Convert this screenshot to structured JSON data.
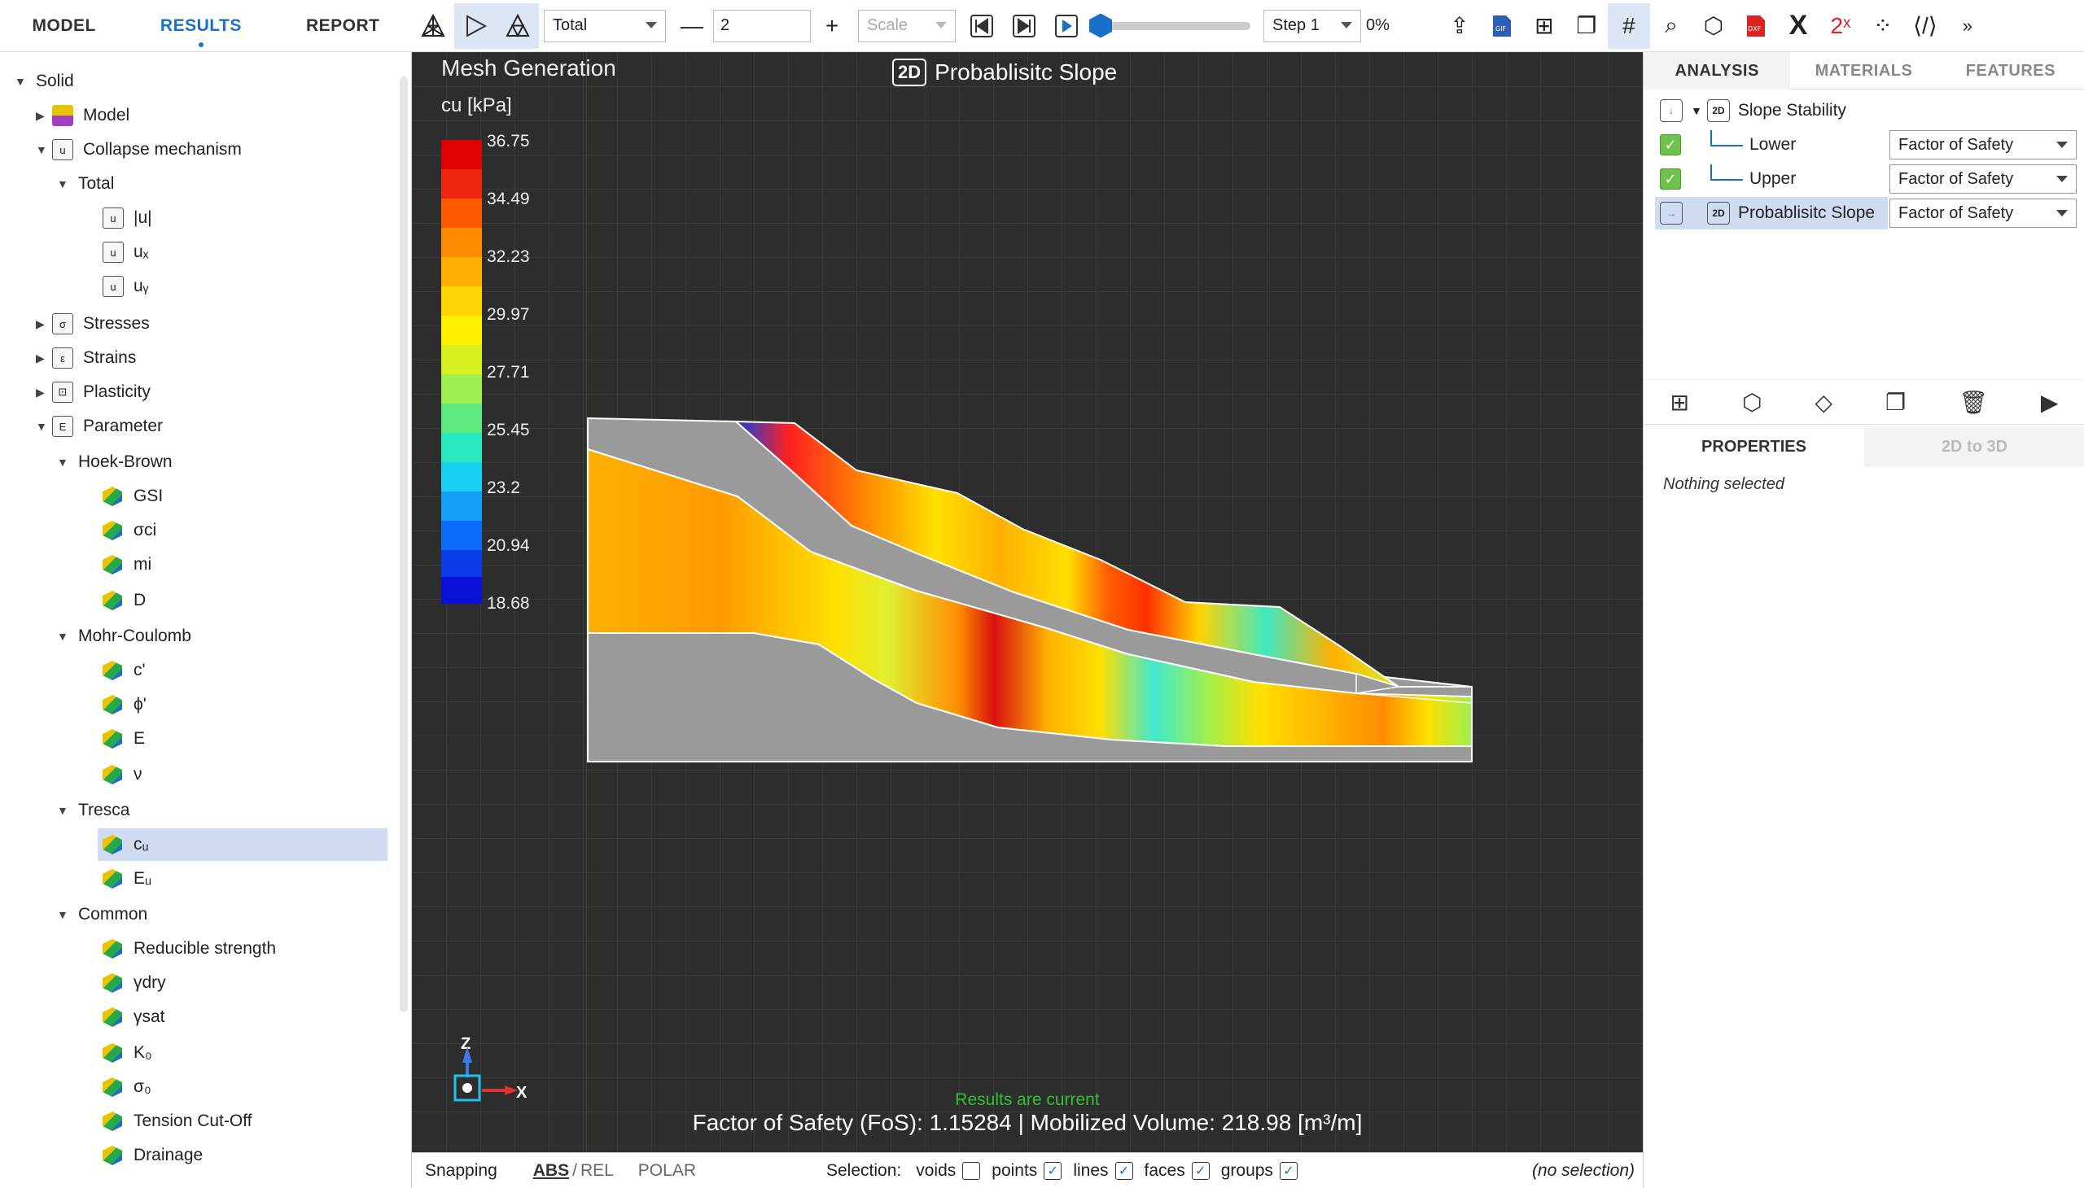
{
  "nav": {
    "model": "MODEL",
    "results": "RESULTS",
    "report": "REPORT"
  },
  "toolbar": {
    "result_type": "Total",
    "step_size": "2",
    "scale_placeholder": "Scale",
    "step_select": "Step 1",
    "progress_percent": "0%",
    "progress_value": 0
  },
  "tree": {
    "solid": "Solid",
    "model": "Model",
    "collapse": "Collapse mechanism",
    "total": "Total",
    "u_abs": "|u|",
    "ux": "uₓ",
    "uy": "uᵧ",
    "stresses": "Stresses",
    "strains": "Strains",
    "plasticity": "Plasticity",
    "parameter": "Parameter",
    "hoek_brown": "Hoek-Brown",
    "gsi": "GSI",
    "sigma_ci": "σci",
    "mi": "mi",
    "d": "D",
    "mohr_coulomb": "Mohr-Coulomb",
    "c_prime": "c'",
    "phi_prime": "ϕ'",
    "e": "E",
    "nu": "ν",
    "tresca": "Tresca",
    "cu": "cᵤ",
    "eu": "Eᵤ",
    "common": "Common",
    "reducible": "Reducible strength",
    "gamma_dry": "γdry",
    "gamma_sat": "γsat",
    "k0": "K₀",
    "sigma0": "σ₀",
    "tension": "Tension Cut-Off",
    "drainage": "Drainage"
  },
  "viewport": {
    "title": "Mesh Generation",
    "badge": "2D",
    "model_name": "Probablisitc Slope",
    "legend_label": "cu [kPa]",
    "legend_ticks": [
      "36.75",
      "34.49",
      "32.23",
      "29.97",
      "27.71",
      "25.45",
      "23.2",
      "20.94",
      "18.68"
    ],
    "status": "Results are current",
    "fos_text": "Factor of Safety (FoS): 1.15284 | Mobilized Volume: 218.98 [m³/m]",
    "axis_z": "Z",
    "axis_x": "X"
  },
  "statusbar": {
    "snapping": "Snapping",
    "abs": "ABS",
    "slash": "/",
    "rel": "REL",
    "polar": "POLAR",
    "selection": "Selection:",
    "voids": "voids",
    "points": "points",
    "lines": "lines",
    "faces": "faces",
    "groups": "groups",
    "no_selection": "(no selection)",
    "check": "✓"
  },
  "right": {
    "tab_analysis": "ANALYSIS",
    "tab_materials": "MATERIALS",
    "tab_features": "FEATURES",
    "slope_stability": "Slope Stability",
    "lower": "Lower",
    "upper": "Upper",
    "prob_slope": "Probablisitc Slope",
    "fos_option": "Factor of Safety",
    "props_tab": "PROPERTIES",
    "to3d_tab": "2D to 3D",
    "nothing_selected": "Nothing selected"
  },
  "colors": {
    "accent": "#1b6fc7",
    "viewport_bg": "#2d2d2d",
    "status_green": "#30c030"
  }
}
